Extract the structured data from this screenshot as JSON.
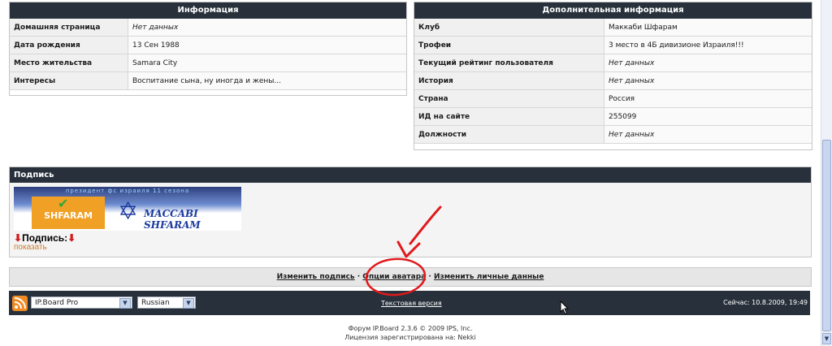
{
  "info_panel": {
    "title": "Информация",
    "rows": [
      {
        "label": "Домашняя страница",
        "value": "Нет данных"
      },
      {
        "label": "Дата рождения",
        "value": "13 Сен 1988"
      },
      {
        "label": "Место жительства",
        "value": "Samara City"
      },
      {
        "label": "Интересы",
        "value": "Воспитание сына, ну иногда и жены..."
      }
    ]
  },
  "extra_panel": {
    "title": "Дополнительная информация",
    "rows": [
      {
        "label": "Клуб",
        "value": "Маккаби Шфарам"
      },
      {
        "label": "Трофеи",
        "value": "3 место в 4Б дивизионе Израиля!!!"
      },
      {
        "label": "Текущий рейтинг пользователя",
        "value": "Нет данных"
      },
      {
        "label": "История",
        "value": "Нет данных"
      },
      {
        "label": "Страна",
        "value": "Россия"
      },
      {
        "label": "ИД на сайте",
        "value": "255099"
      },
      {
        "label": "Должности",
        "value": "Нет данных"
      }
    ]
  },
  "signature": {
    "title": "Подпись",
    "banner": {
      "top_text": "президент фс израиля 11 сезона",
      "left_logo": "SHFARAM",
      "right_logo": "MACCABI SHFARAM"
    },
    "label": "Подпись:",
    "show_link": "показать"
  },
  "links": {
    "edit_signature": "Изменить подпись",
    "avatar_options": "Опции аватара",
    "edit_personal": "Изменить личные данные",
    "separator": "·"
  },
  "footer": {
    "skin_value": "IP.Board Pro",
    "lang_value": "Russian",
    "text_version": "Текстовая версия",
    "time_now": "Сейчас: 10.8.2009, 19:49"
  },
  "copyright": {
    "line1": "Форум IP.Board 2.3.6 © 2009  IPS, Inc.",
    "line2": "Лицензия зарегистрирована на: Nekki"
  },
  "colors": {
    "header_bg": "#28313b",
    "annotation": "#e0191c",
    "link_accent": "#c97a2e"
  }
}
